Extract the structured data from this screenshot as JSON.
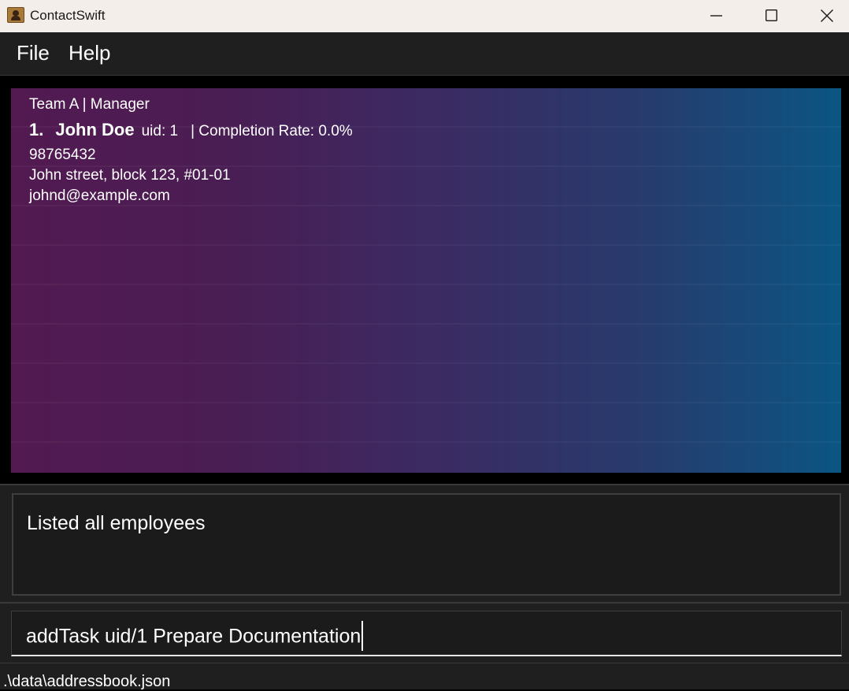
{
  "window": {
    "title": "ContactSwift",
    "icon": "contact-book-icon",
    "controls": [
      "minimize-icon",
      "maximize-icon",
      "close-icon"
    ]
  },
  "menu": {
    "file": "File",
    "help": "Help"
  },
  "employee_list": [
    {
      "team_role": "Team A | Manager",
      "index": "1.",
      "name": "John Doe",
      "uid": "uid: 1",
      "completion": "| Completion Rate: 0.0%",
      "phone": "98765432",
      "address": "John street, block 123, #01-01",
      "email": "johnd@example.com"
    }
  ],
  "result": {
    "message": "Listed all employees"
  },
  "command": {
    "value": "addTask uid/1 Prepare Documentation"
  },
  "status": {
    "path": ".\\data\\addressbook.json"
  },
  "colors": {
    "card_gradient_start": "#521a51",
    "card_gradient_end": "#0b5583",
    "panel_bg": "#1f1f1f",
    "titlebar_bg": "#f3eeea"
  }
}
